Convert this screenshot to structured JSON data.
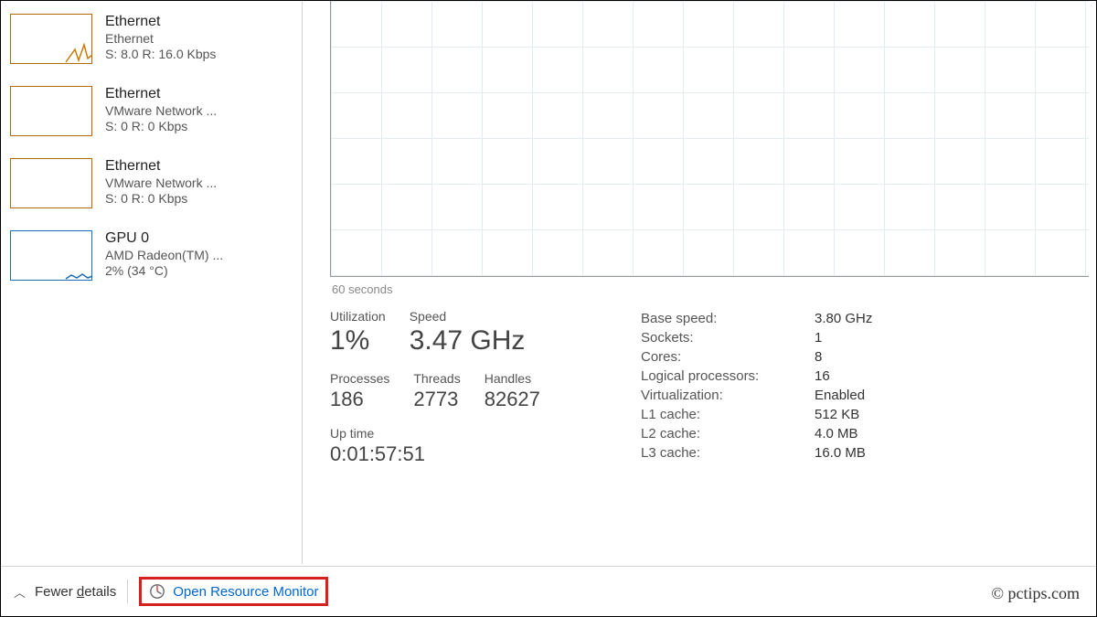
{
  "sidebar": {
    "items": [
      {
        "title": "Ethernet",
        "sub": "Ethernet",
        "stat": "S: 8.0 R: 16.0 Kbps",
        "kind": "eth",
        "spark": "peak"
      },
      {
        "title": "Ethernet",
        "sub": "VMware Network ...",
        "stat": "S: 0 R: 0 Kbps",
        "kind": "eth",
        "spark": "flat"
      },
      {
        "title": "Ethernet",
        "sub": "VMware Network ...",
        "stat": "S: 0 R: 0 Kbps",
        "kind": "eth",
        "spark": "flat"
      },
      {
        "title": "GPU 0",
        "sub": "AMD Radeon(TM) ...",
        "stat": "2% (34 °C)",
        "kind": "gpu",
        "spark": "tiny"
      }
    ]
  },
  "chart": {
    "axis_label": "60 seconds"
  },
  "metrics": {
    "utilization_label": "Utilization",
    "utilization": "1%",
    "speed_label": "Speed",
    "speed": "3.47 GHz",
    "processes_label": "Processes",
    "processes": "186",
    "threads_label": "Threads",
    "threads": "2773",
    "handles_label": "Handles",
    "handles": "82627",
    "uptime_label": "Up time",
    "uptime": "0:01:57:51"
  },
  "details": [
    {
      "k": "Base speed:",
      "v": "3.80 GHz"
    },
    {
      "k": "Sockets:",
      "v": "1"
    },
    {
      "k": "Cores:",
      "v": "8"
    },
    {
      "k": "Logical processors:",
      "v": "16"
    },
    {
      "k": "Virtualization:",
      "v": "Enabled"
    },
    {
      "k": "L1 cache:",
      "v": "512 KB"
    },
    {
      "k": "L2 cache:",
      "v": "4.0 MB"
    },
    {
      "k": "L3 cache:",
      "v": "16.0 MB"
    }
  ],
  "footer": {
    "fewer_details": "Fewer details",
    "open_resource_monitor": "Open Resource Monitor"
  },
  "copyright": "© pctips.com"
}
